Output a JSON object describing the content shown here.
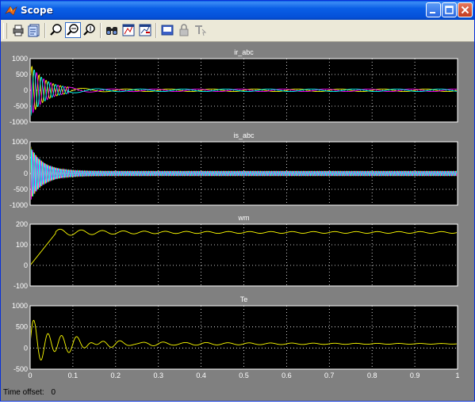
{
  "window": {
    "title": "Scope"
  },
  "toolbar": {
    "items": [
      "print-icon",
      "parameters-icon",
      "zoom-icon",
      "zoom-x-icon",
      "zoom-y-icon",
      "autoscale-icon",
      "save-axes-icon",
      "restore-axes-icon",
      "floating-scope-icon",
      "lock-axes-icon",
      "signal-selection-icon"
    ]
  },
  "status": {
    "time_offset_label": "Time offset:",
    "time_offset_value": "0"
  },
  "colors": {
    "plot_bg": "#000000",
    "frame": "#808080",
    "yellow": "#ffff00",
    "magenta": "#ff00ff",
    "cyan": "#00ffff"
  },
  "chart_data": [
    {
      "type": "line",
      "title": "ir_abc",
      "xlim": [
        0,
        1
      ],
      "ylim": [
        -1000,
        1000
      ],
      "y_ticks": [
        "-1000",
        "-500",
        "0",
        "500",
        "1000"
      ],
      "grid": true,
      "series": [
        {
          "color": "#ffff00",
          "values": [
            0,
            600,
            -500,
            -100,
            30,
            20,
            15,
            12,
            10
          ]
        },
        {
          "color": "#ff00ff",
          "values": [
            0,
            -700,
            -600,
            200,
            80,
            40,
            30,
            25,
            20
          ]
        },
        {
          "color": "#00ffff",
          "values": [
            0,
            750,
            400,
            -200,
            -40,
            -20,
            -15,
            -12,
            -10
          ]
        }
      ]
    },
    {
      "type": "line",
      "title": "is_abc",
      "xlim": [
        0,
        1
      ],
      "ylim": [
        -1000,
        1000
      ],
      "y_ticks": [
        "-1000",
        "-500",
        "0",
        "500",
        "1000"
      ],
      "grid": true,
      "series": [
        {
          "color": "#ffff00",
          "values": [
            850,
            200,
            100,
            80,
            60
          ]
        },
        {
          "color": "#ff00ff",
          "values": [
            850,
            200,
            100,
            80,
            60
          ]
        },
        {
          "color": "#00ffff",
          "values": [
            850,
            200,
            100,
            80,
            60
          ]
        }
      ]
    },
    {
      "type": "line",
      "title": "wm",
      "xlim": [
        0,
        1
      ],
      "ylim": [
        -100,
        200
      ],
      "y_ticks": [
        "-100",
        "0",
        "100",
        "200"
      ],
      "grid": true,
      "series": [
        {
          "color": "#ffff00",
          "values": [
            0,
            40,
            100,
            160,
            170,
            150,
            165,
            155,
            160,
            158,
            160
          ]
        }
      ]
    },
    {
      "type": "line",
      "title": "Te",
      "xlim": [
        0,
        1
      ],
      "ylim": [
        -500,
        1000
      ],
      "x_ticks": [
        "0",
        "0.1",
        "0.2",
        "0.3",
        "0.4",
        "0.5",
        "0.6",
        "0.7",
        "0.8",
        "0.9",
        "1"
      ],
      "y_ticks": [
        "-500",
        "0",
        "500",
        "1000"
      ],
      "grid": true,
      "series": [
        {
          "color": "#ffff00",
          "values": [
            0,
            700,
            200,
            650,
            550,
            -200,
            200,
            50,
            100
          ]
        }
      ]
    }
  ]
}
